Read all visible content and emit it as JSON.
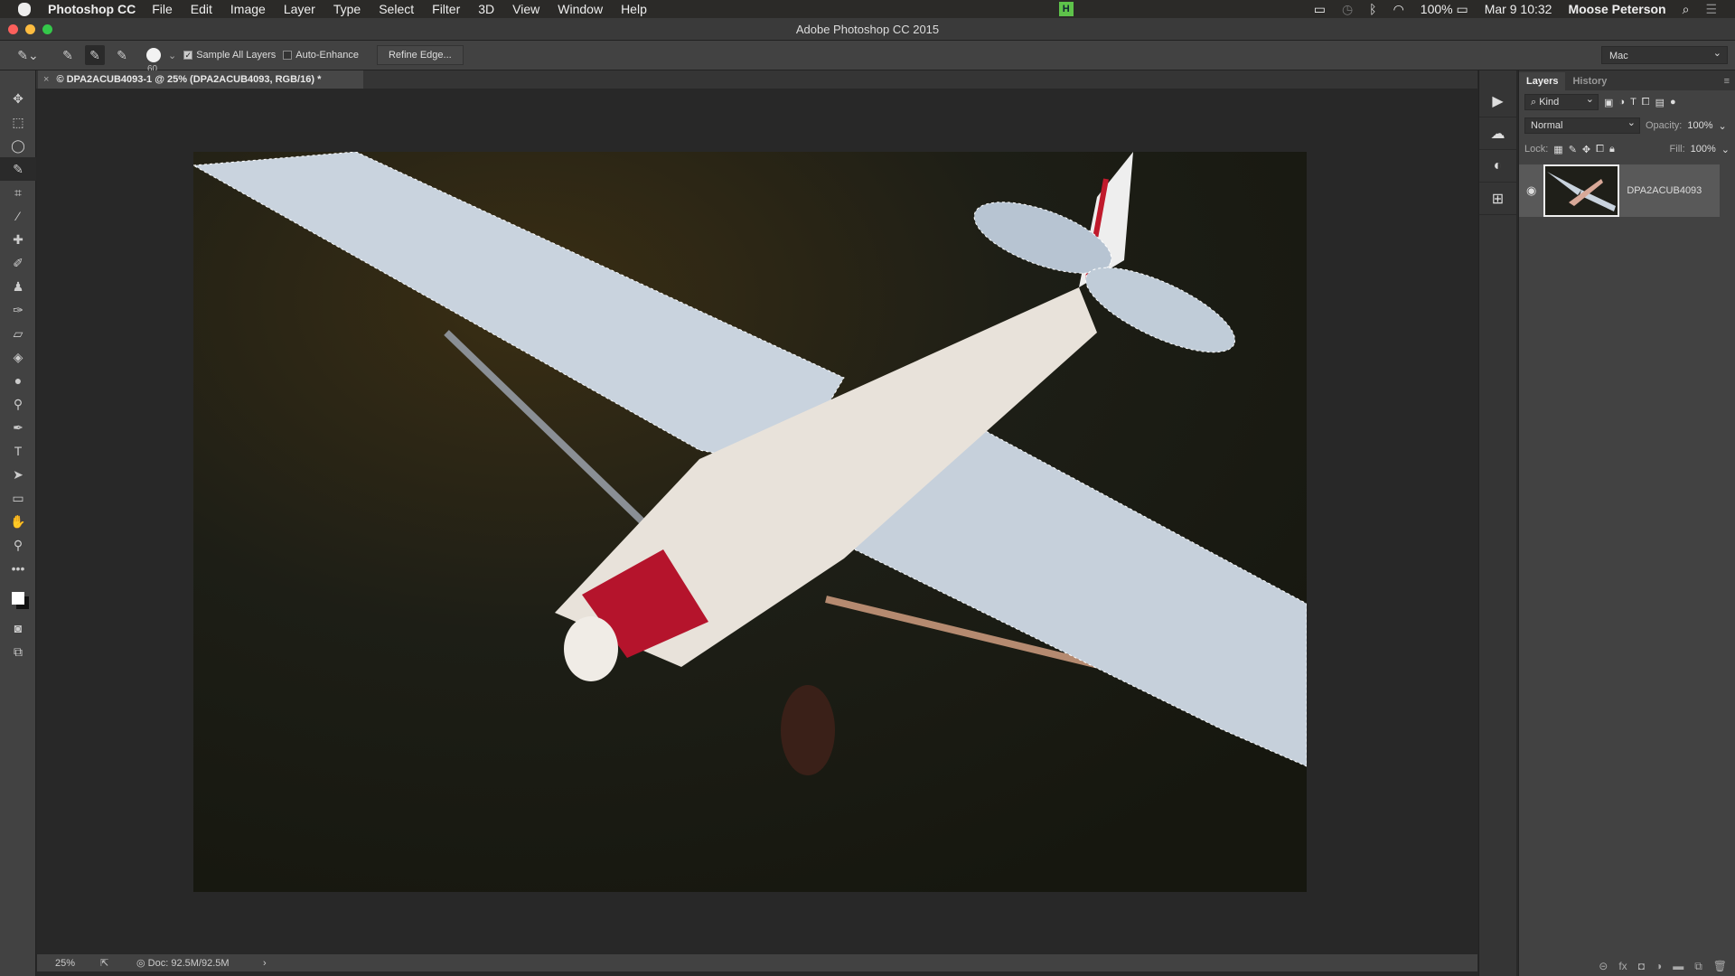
{
  "menubar": {
    "app": "Photoshop CC",
    "items": [
      "File",
      "Edit",
      "Image",
      "Layer",
      "Type",
      "Select",
      "Filter",
      "3D",
      "View",
      "Window",
      "Help"
    ],
    "battery": "100%",
    "datetime": "Mar 9  10:32",
    "user": "Moose Peterson",
    "badge": "H"
  },
  "window": {
    "title": "Adobe Photoshop CC 2015"
  },
  "options": {
    "brush_size": "60",
    "sample_all_layers": {
      "label": "Sample All Layers",
      "checked": true
    },
    "auto_enhance": {
      "label": "Auto-Enhance",
      "checked": false
    },
    "refine_edge": "Refine Edge...",
    "workspace": "Mac"
  },
  "document": {
    "tab_title": "© DPA2ACUB4093-1 @ 25% (DPA2ACUB4093, RGB/16) *",
    "close": "×"
  },
  "status": {
    "zoom": "25%",
    "doc": "◎ Doc: 92.5M/92.5M",
    "arrow": "›"
  },
  "layers_panel": {
    "tabs": [
      "Layers",
      "History"
    ],
    "active_tab": "Layers",
    "filter": "Kind",
    "blend_mode": "Normal",
    "opacity_label": "Opacity:",
    "opacity": "100%",
    "lock_label": "Lock:",
    "fill_label": "Fill:",
    "fill": "100%",
    "layers": [
      {
        "name": "DPA2ACUB4093",
        "visible": true
      }
    ]
  },
  "colors": {
    "accent_selected": "#2a2a2a",
    "panel_bg": "#424242",
    "canvas_bg": "#282828"
  }
}
